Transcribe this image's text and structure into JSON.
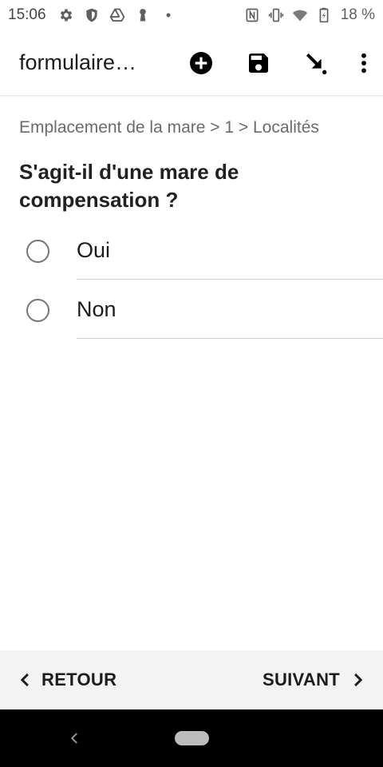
{
  "status_bar": {
    "time": "15:06",
    "left_icons": [
      "gear-icon",
      "shield-icon",
      "drive-icon",
      "keyhole-icon",
      "dot-icon"
    ],
    "right_icons": [
      "nfc-icon",
      "vibrate-icon",
      "wifi-icon",
      "battery-icon"
    ],
    "battery_text": "18 %"
  },
  "app_bar": {
    "title": "formulaire…",
    "actions": [
      "add-circle-icon",
      "save-icon",
      "arrow-down-right-icon",
      "more-vert-icon"
    ]
  },
  "breadcrumb": "Emplacement de la mare > 1 > Localités",
  "question": "S'agit-il d'une mare de compensation ?",
  "options": [
    {
      "label": "Oui",
      "selected": false
    },
    {
      "label": "Non",
      "selected": false
    }
  ],
  "navigation": {
    "back_label": "RETOUR",
    "next_label": "SUIVANT"
  },
  "colors": {
    "bottom_bar_bg": "#f3f3f3",
    "system_nav_bg": "#000000",
    "radio_border": "#757575"
  }
}
